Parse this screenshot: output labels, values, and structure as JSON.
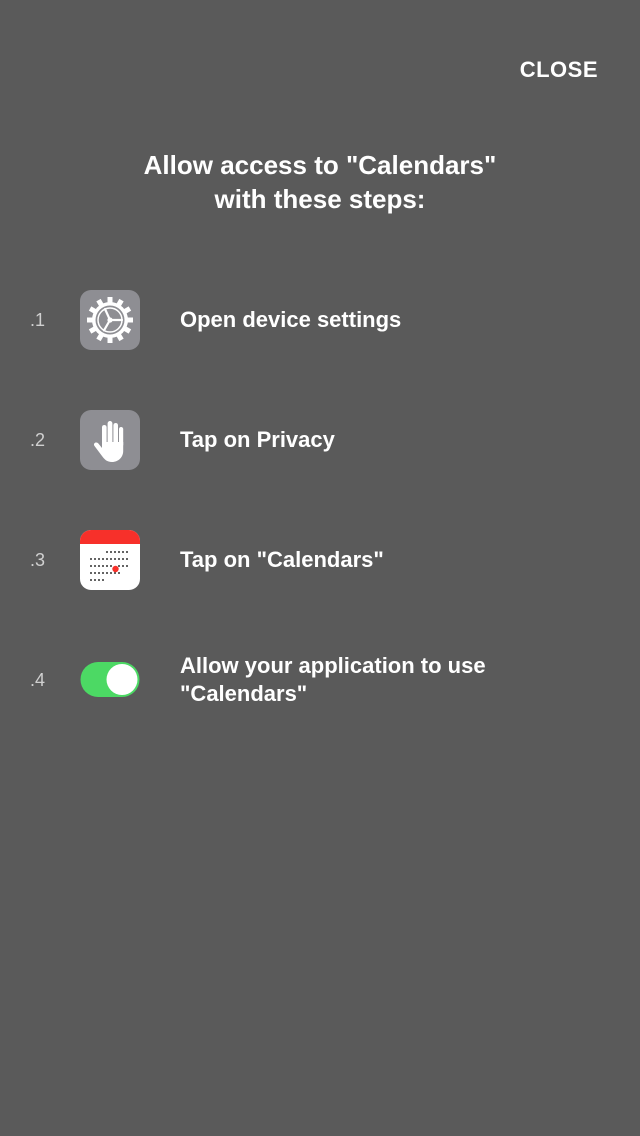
{
  "header": {
    "close_label": "CLOSE"
  },
  "title": {
    "line1": "Allow access to \"Calendars\"",
    "line2": "with these steps:"
  },
  "steps": [
    {
      "number": ".1",
      "icon": "settings-gear-icon",
      "text": "Open device settings"
    },
    {
      "number": ".2",
      "icon": "privacy-hand-icon",
      "text": "Tap on Privacy"
    },
    {
      "number": ".3",
      "icon": "calendar-icon",
      "text": "Tap on \"Calendars\""
    },
    {
      "number": ".4",
      "icon": "toggle-switch-icon",
      "text": "Allow your application to use \"Calendars\""
    }
  ],
  "colors": {
    "background": "#5a5a5a",
    "icon_gray": "#8e8e93",
    "calendar_red": "#f7302a",
    "toggle_green": "#4cd964"
  }
}
